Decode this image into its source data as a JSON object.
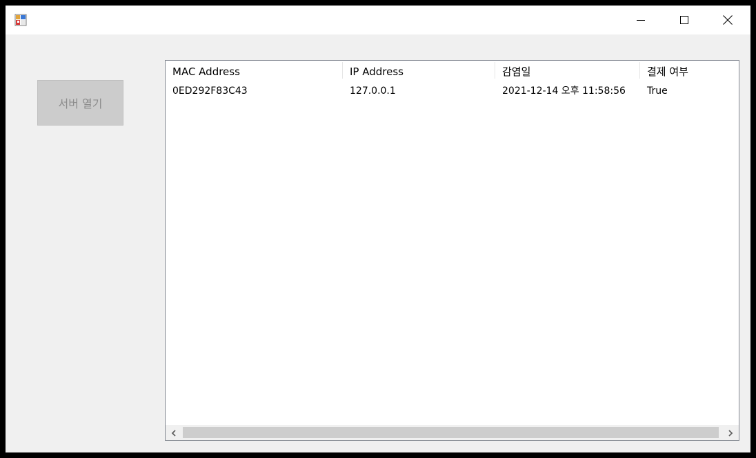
{
  "window": {
    "icons": {
      "app": "app-window-icon",
      "minimize": "minimize-icon",
      "maximize": "maximize-icon",
      "close": "close-icon"
    }
  },
  "server_button": {
    "label": "서버 열기"
  },
  "listview": {
    "columns": [
      "MAC Address",
      "IP Address",
      "감염일",
      "결제 여부"
    ],
    "rows": [
      [
        "0ED292F83C43",
        "127.0.0.1",
        "2021-12-14 오후 11:58:56",
        "True"
      ]
    ],
    "scrollbar": {
      "left_icon": "chevron-left-icon",
      "right_icon": "chevron-right-icon"
    }
  },
  "colors": {
    "window_bg": "#f0f0f0",
    "titlebar_bg": "#ffffff",
    "button_disabled_bg": "#cccccc",
    "button_disabled_text": "#8c8c8c",
    "list_border": "#828790",
    "scroll_thumb": "#cdcdcd"
  }
}
